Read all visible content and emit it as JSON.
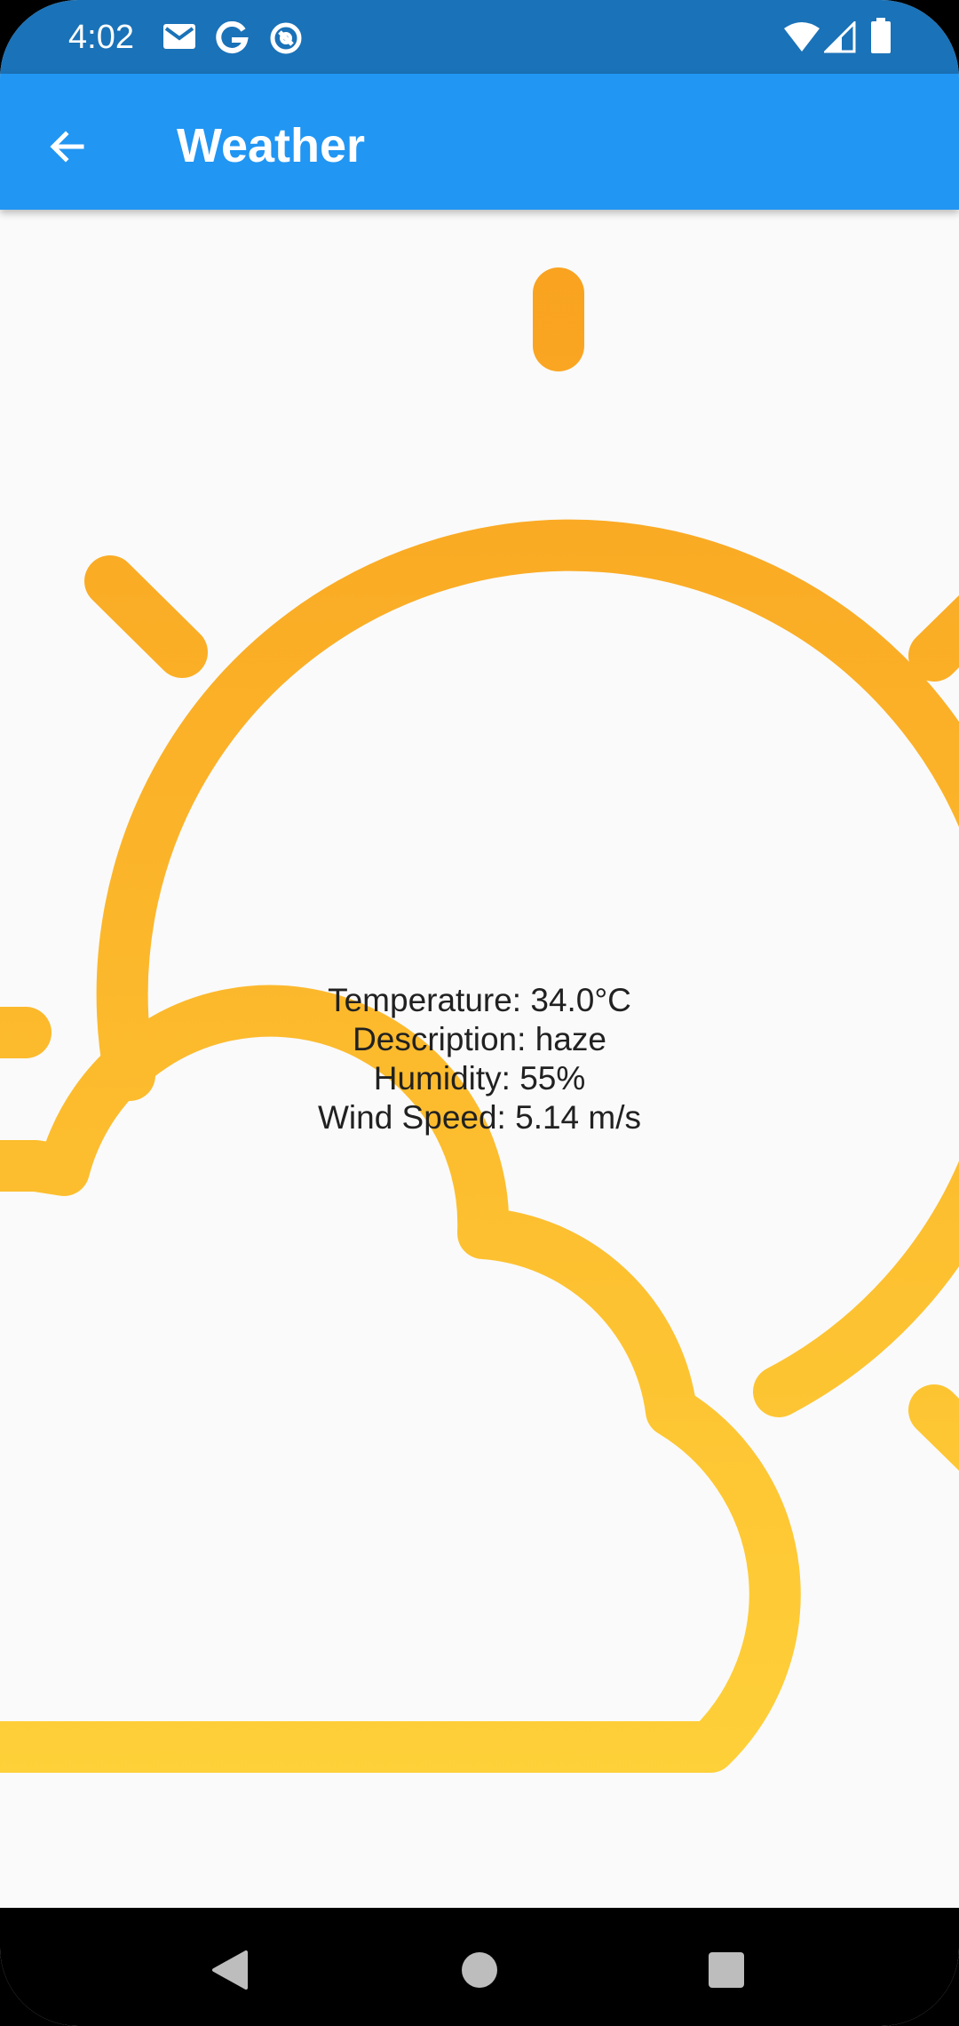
{
  "status_bar": {
    "time": "4:02",
    "left_icons": [
      "gmail-icon",
      "google-icon",
      "at-sign-icon"
    ],
    "right_icons": [
      "wifi-icon",
      "cellular-signal-icon",
      "battery-icon"
    ]
  },
  "app_bar": {
    "back_icon": "arrow-back-icon",
    "title": "Weather"
  },
  "weather": {
    "illustration": "partly-sunny-icon",
    "temperature": "Temperature: 34.0°C",
    "description": "Description: haze",
    "humidity": "Humidity: 55%",
    "wind_speed": "Wind Speed: 5.14 m/s"
  },
  "nav_bar": {
    "back": "nav-back-icon",
    "home": "nav-home-icon",
    "recents": "nav-recents-icon"
  },
  "colors": {
    "status_bar": "#1a72b8",
    "app_bar": "#2196f3",
    "background": "#fafafa",
    "sun_top": "#f9a11f",
    "sun_bottom": "#ffd43b",
    "text": "#212121"
  }
}
